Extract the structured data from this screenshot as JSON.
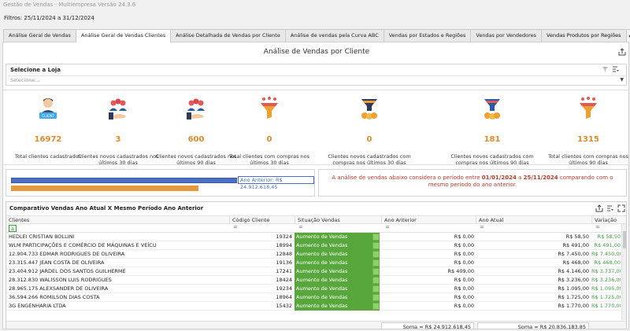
{
  "window": {
    "title": "Gestão de Vendas - Multiempresa Versão 24.3.6"
  },
  "filters": {
    "text": "Filtros: 25/11/2024 a 31/12/2024"
  },
  "tabs": [
    {
      "label": "Análise Geral de Vendas"
    },
    {
      "label": "Análise Geral de Vendas Clientes"
    },
    {
      "label": "Análise Detalhada de Vendas por Cliente"
    },
    {
      "label": "Análise de vendas pela Curva ABC"
    },
    {
      "label": "Vendas por Estados e Regiões"
    },
    {
      "label": "Vendas por Vendedores"
    },
    {
      "label": "Vendas Produtos por Regiões"
    }
  ],
  "page": {
    "title": "Análise de Vendas por Cliente"
  },
  "loja": {
    "title": "Selecione a Loja",
    "placeholder": "Selecione..."
  },
  "kpis": [
    {
      "icon": "client-icon",
      "value": "16972",
      "label": "Total clientes cadastrados"
    },
    {
      "icon": "new-clients-icon",
      "value": "3",
      "label": "Clientes novos cadastrados nos últimos 30 dias"
    },
    {
      "icon": "new-clients-icon",
      "value": "600",
      "label": "Clientes novos cadastrados nos últimos 90 dias"
    },
    {
      "icon": "funnel-icon",
      "value": "0",
      "label": "Total clientes com compras nos últimos 30 dias"
    },
    {
      "icon": "funnel-coins-icon",
      "value": "0",
      "label": "Clientes novos cadastrados com compras nos últimos 30 dias"
    },
    {
      "icon": "funnel-coins-icon",
      "value": "181",
      "label": "Clientes novos cadastrados com compras nos últimos 90 dias"
    },
    {
      "icon": "funnel-icon",
      "value": "1315",
      "label": "Total clientes com compras nos últimos 90 dias"
    }
  ],
  "comparison_bar": {
    "label": "Ano Anterior: R$ 24.912.618,45",
    "current_fraction": 0.83,
    "previous_fraction": 1.0,
    "current_color": "#4b6fc4",
    "previous_color": "#e39a3e"
  },
  "note": {
    "prefix": "A análise de vendas abaixo considera o período entre ",
    "date1": "01/01/2024",
    "mid": " a ",
    "date2": "25/11/2024",
    "suffix": " comparando com o mesmo período do ano anterior."
  },
  "grid": {
    "title": "Comparativo Vendas Ano Atual X Mesmo Período Ano Anterior",
    "columns": [
      "Clientes",
      "Código Cliente",
      "Situação Vendas",
      "Ano Anterior",
      "Ano Atual",
      "Variação"
    ],
    "rows": [
      [
        "HEDLEI CRISTIAN BOLLINI",
        "19324",
        "Aumento de Vendas",
        "R$ 0,00",
        "R$ 58,50",
        "R$ 58,50"
      ],
      [
        "WLM PARTICIPAÇÕES E COMÉRCIO DE MÁQUINAS  E VEÍCU",
        "18994",
        "Aumento de Vendas",
        "R$ 0,00",
        "R$ 491,00",
        "R$ 491,00"
      ],
      [
        "12.904.733 EDMAR RODRIGUES DE OLIVEIRA",
        "12848",
        "Aumento de Vendas",
        "R$ 0,00",
        "R$ 7.450,00",
        "R$ 7.450,00"
      ],
      [
        "23.315.447 JEAN COSTA DE OLIVEIRA",
        "19136",
        "Aumento de Vendas",
        "R$ 0,00",
        "R$ 468,00",
        "R$ 468,00"
      ],
      [
        "23.404.912 JARDEL DOS SANTOS GUILHERME",
        "17241",
        "Aumento de Vendas",
        "R$ 409,00",
        "R$ 4.146,00",
        "R$ 3.737,00"
      ],
      [
        "28.312.830 WALISSON LUIS RODRIGUES",
        "18424",
        "Aumento de Vendas",
        "R$ 0,00",
        "R$ 3.236,00",
        "R$ 3.236,00"
      ],
      [
        "28.965.175 ALEXSANDER DE OLIVEIRA",
        "19234",
        "Aumento de Vendas",
        "R$ 0,00",
        "R$ 1.095,00",
        "R$ 1.095,00"
      ],
      [
        "36.594.266 ROMILSON DIAS COSTA",
        "18964",
        "Aumento de Vendas",
        "R$ 0,00",
        "R$ 1.725,00",
        "R$ 1.725,00"
      ],
      [
        "3G ENGENHARIA LTDA",
        "15432",
        "Aumento de Vendas",
        "R$ 0,00",
        "R$ 1.770,00",
        "R$ 1.770,00"
      ]
    ],
    "sum_prev": "Soma = R$ 24.912.618,45",
    "sum_curr": "Soma = R$ 20.836.183,85"
  },
  "colors": {
    "accent": "#e08a2a",
    "positive": "#3ca03c",
    "status_bg": "#58a73c",
    "note_text": "#c0392b"
  }
}
